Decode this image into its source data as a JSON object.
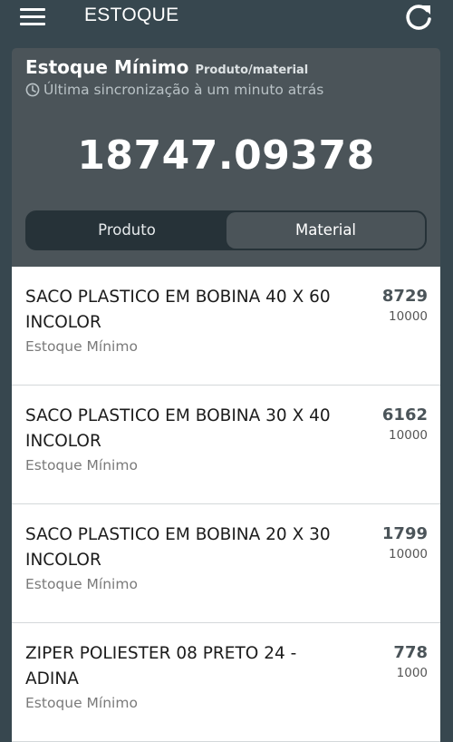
{
  "appbar": {
    "title": "ESTOQUE",
    "menu_icon": "hamburger-menu-icon",
    "refresh_icon": "refresh-icon"
  },
  "summary": {
    "title": "Estoque Mínimo",
    "subtitle": "Produto/material",
    "sync_icon": "clock-icon",
    "sync_text": "Última sincronização à um minuto atrás",
    "total": "18747.09378"
  },
  "toggle": {
    "options": [
      "Produto",
      "Material"
    ],
    "selected": "Material"
  },
  "items": [
    {
      "name": "SACO PLASTICO EM BOBINA 40 X 60 INCOLOR",
      "label": "Estoque Mínimo",
      "qty": "8729",
      "min": "10000"
    },
    {
      "name": "SACO PLASTICO EM BOBINA 30 X 40 INCOLOR",
      "label": "Estoque Mínimo",
      "qty": "6162",
      "min": "10000"
    },
    {
      "name": "SACO PLASTICO EM BOBINA 20 X 30 INCOLOR",
      "label": "Estoque Mínimo",
      "qty": "1799",
      "min": "10000"
    },
    {
      "name": "ZIPER POLIESTER 08 PRETO 24 - ADINA",
      "label": "Estoque Mínimo",
      "qty": "778",
      "min": "1000"
    }
  ],
  "colors": {
    "background": "#37474f",
    "card": "#4b5459",
    "toggle_track": "#263238",
    "quantity": "#4b5459"
  }
}
